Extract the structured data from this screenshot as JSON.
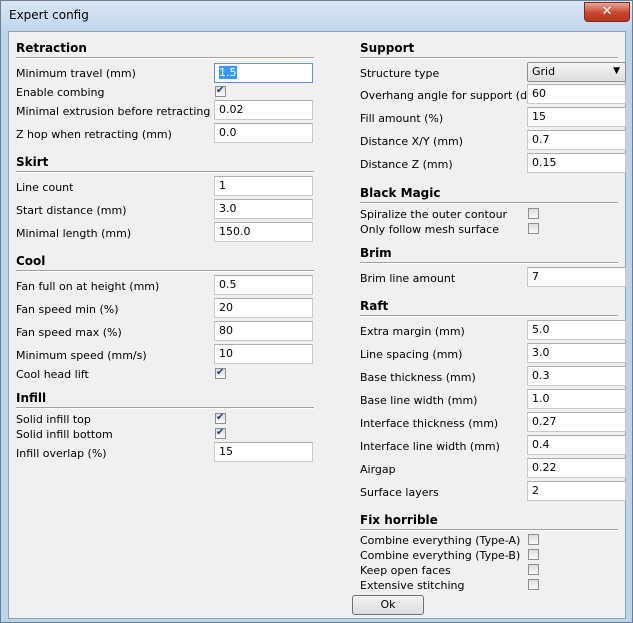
{
  "window": {
    "title": "Expert config",
    "close_glyph": "✕",
    "ok_label": "Ok"
  },
  "left": {
    "retraction": {
      "title": "Retraction",
      "minimum_travel": {
        "label": "Minimum travel (mm)",
        "value": "1.5"
      },
      "enable_combing": {
        "label": "Enable combing",
        "checked": true
      },
      "min_extrusion": {
        "label": "Minimal extrusion before retracting (mm)",
        "value": "0.02"
      },
      "z_hop": {
        "label": "Z hop when retracting (mm)",
        "value": "0.0"
      }
    },
    "skirt": {
      "title": "Skirt",
      "line_count": {
        "label": "Line count",
        "value": "1"
      },
      "start_distance": {
        "label": "Start distance (mm)",
        "value": "3.0"
      },
      "minimal_length": {
        "label": "Minimal length (mm)",
        "value": "150.0"
      }
    },
    "cool": {
      "title": "Cool",
      "fan_full_height": {
        "label": "Fan full on at height (mm)",
        "value": "0.5"
      },
      "fan_speed_min": {
        "label": "Fan speed min (%)",
        "value": "20"
      },
      "fan_speed_max": {
        "label": "Fan speed max (%)",
        "value": "80"
      },
      "minimum_speed": {
        "label": "Minimum speed (mm/s)",
        "value": "10"
      },
      "cool_head_lift": {
        "label": "Cool head lift",
        "checked": true
      }
    },
    "infill": {
      "title": "Infill",
      "solid_top": {
        "label": "Solid infill top",
        "checked": true
      },
      "solid_bottom": {
        "label": "Solid infill bottom",
        "checked": true
      },
      "overlap": {
        "label": "Infill overlap (%)",
        "value": "15"
      }
    }
  },
  "right": {
    "support": {
      "title": "Support",
      "structure_type": {
        "label": "Structure type",
        "value": "Grid"
      },
      "overhang_angle": {
        "label": "Overhang angle for support (deg)",
        "value": "60"
      },
      "fill_amount": {
        "label": "Fill amount (%)",
        "value": "15"
      },
      "distance_xy": {
        "label": "Distance X/Y (mm)",
        "value": "0.7"
      },
      "distance_z": {
        "label": "Distance Z (mm)",
        "value": "0.15"
      }
    },
    "black_magic": {
      "title": "Black Magic",
      "spiralize": {
        "label": "Spiralize the outer contour",
        "checked": false
      },
      "only_follow_mesh": {
        "label": "Only follow mesh surface",
        "checked": false
      }
    },
    "brim": {
      "title": "Brim",
      "line_amount": {
        "label": "Brim line amount",
        "value": "7"
      }
    },
    "raft": {
      "title": "Raft",
      "extra_margin": {
        "label": "Extra margin (mm)",
        "value": "5.0"
      },
      "line_spacing": {
        "label": "Line spacing (mm)",
        "value": "3.0"
      },
      "base_thickness": {
        "label": "Base thickness (mm)",
        "value": "0.3"
      },
      "base_line_width": {
        "label": "Base line width (mm)",
        "value": "1.0"
      },
      "interface_thickness": {
        "label": "Interface thickness (mm)",
        "value": "0.27"
      },
      "interface_line_width": {
        "label": "Interface line width (mm)",
        "value": "0.4"
      },
      "airgap": {
        "label": "Airgap",
        "value": "0.22"
      },
      "surface_layers": {
        "label": "Surface layers",
        "value": "2"
      }
    },
    "fix_horrible": {
      "title": "Fix horrible",
      "combine_a": {
        "label": "Combine everything (Type-A)",
        "checked": false
      },
      "combine_b": {
        "label": "Combine everything (Type-B)",
        "checked": false
      },
      "keep_open_faces": {
        "label": "Keep open faces",
        "checked": false
      },
      "extensive_stitching": {
        "label": "Extensive stitching",
        "checked": false
      }
    }
  }
}
